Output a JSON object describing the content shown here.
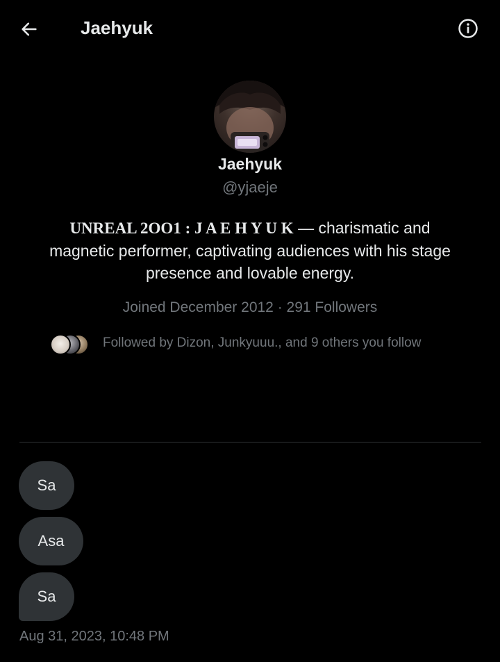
{
  "header": {
    "title": "Jaehyuk"
  },
  "profile": {
    "name": "Jaehyuk",
    "handle": "@yjaeje",
    "bio_styled": "UNREAL 2OO1 : J A E H Y U K",
    "bio_rest": " — charismatic and magnetic performer, captivating audiences with his stage presence and lovable energy.",
    "joined": "Joined December 2012",
    "separator": "·",
    "followers": "291 Followers",
    "followed_by": "Followed by Dizon, Junkyuuu., and 9 others you follow"
  },
  "messages": [
    {
      "text": "Sa"
    },
    {
      "text": "Asa"
    },
    {
      "text": "Sa"
    }
  ],
  "timestamp": "Aug 31, 2023, 10:48 PM",
  "icons": {
    "back": "arrow-left-icon",
    "info": "info-circle-icon"
  },
  "colors": {
    "background": "#000000",
    "primary_text": "#e7e9ea",
    "secondary_text": "#71767b",
    "bubble": "#2f3336",
    "divider": "#2f3336"
  }
}
